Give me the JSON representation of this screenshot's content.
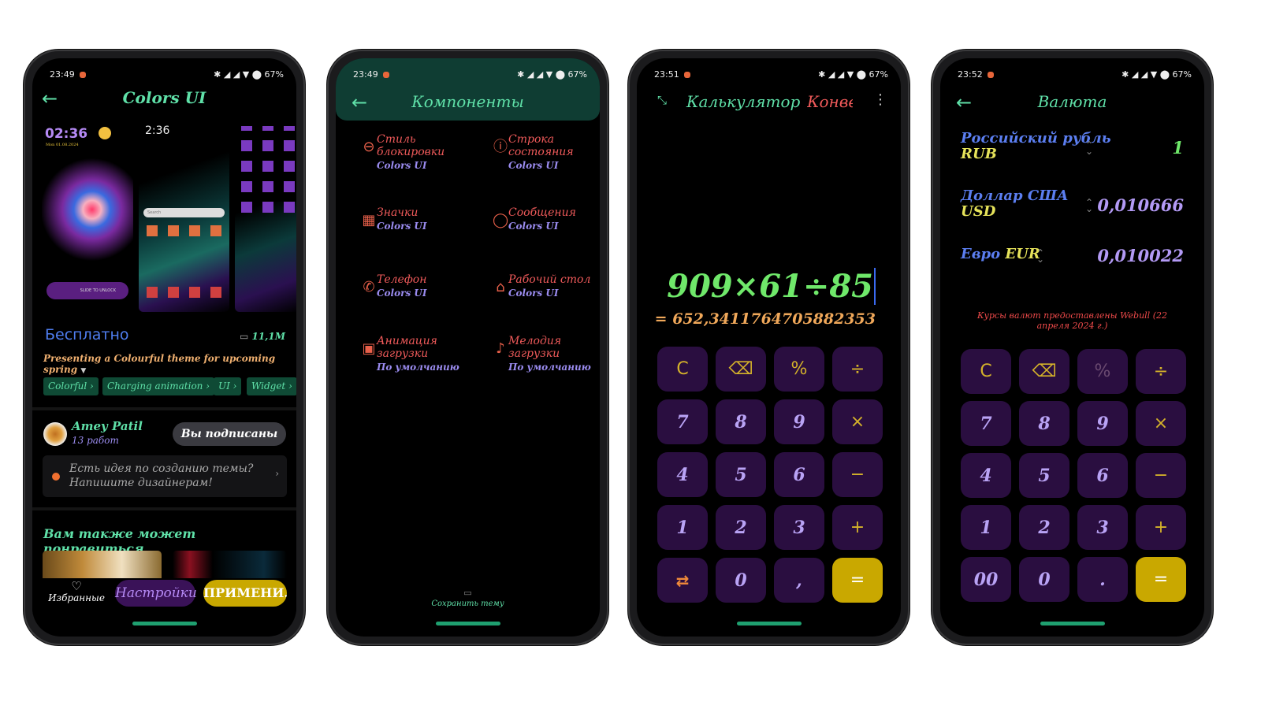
{
  "phone1": {
    "status": {
      "time": "23:49",
      "icons": "✱ ◢ ◢ ▼ ⬤",
      "battery": "67%"
    },
    "title": "Colors UI",
    "preview": {
      "clock1": "02:36",
      "date1": "Mon 01.08.2024",
      "clock2": "2:36",
      "unlock": "SLIDE TO UNLOCK",
      "search": "Search"
    },
    "price": "Бесплатно",
    "size": "11,1M",
    "description": "Presenting a Colourful theme for upcoming spring",
    "tags": [
      "Colorful ›",
      "Charging animation ›",
      "UI ›",
      "Widget ›"
    ],
    "author": {
      "name": "Amey Patil",
      "works": "13 работ",
      "follow": "Вы подписаны"
    },
    "idea": {
      "line1": "Есть идея по созданию темы?",
      "line2": "Напишите дизайнерам!"
    },
    "also": "Вам также может понравиться",
    "bottom": {
      "favorites": "Избранные",
      "settings": "Настройки",
      "apply": "ПРИМЕНИ..."
    }
  },
  "phone2": {
    "status": {
      "time": "23:49",
      "icons": "✱ ◢ ◢ ▼ ⬤",
      "battery": "67%"
    },
    "title": "Компоненты",
    "components": [
      {
        "icon": "lock-icon",
        "title": "Стиль блокировки",
        "sub": "Colors UI"
      },
      {
        "icon": "info-icon",
        "title": "Строка состояния",
        "sub": "Colors UI"
      },
      {
        "icon": "grid-icon",
        "title": "Значки",
        "sub": "Colors UI"
      },
      {
        "icon": "message-icon",
        "title": "Сообщения",
        "sub": "Colors UI"
      },
      {
        "icon": "phone-icon",
        "title": "Телефон",
        "sub": "Colors UI"
      },
      {
        "icon": "home-icon",
        "title": "Рабочий стол",
        "sub": "Colors UI"
      },
      {
        "icon": "boot-animation-icon",
        "title": "Анимация загрузки",
        "sub": "По умолчанию"
      },
      {
        "icon": "ringtone-icon",
        "title": "Мелодия загрузки",
        "sub": "По умолчанию"
      }
    ],
    "save": "Сохранить тему"
  },
  "phone3": {
    "status": {
      "time": "23:51",
      "icons": "✱ ◢ ◢ ▼ ⬤",
      "battery": "67%"
    },
    "tab_calc": "Калькулятор",
    "tab_conv": "Конве",
    "expression": "909×61÷85",
    "result": "= 652,3411764705882353",
    "keys": [
      [
        "C",
        "⌫",
        "%",
        "÷"
      ],
      [
        "7",
        "8",
        "9",
        "×"
      ],
      [
        "4",
        "5",
        "6",
        "−"
      ],
      [
        "1",
        "2",
        "3",
        "+"
      ],
      [
        "⇄",
        "0",
        ",",
        "="
      ]
    ]
  },
  "phone4": {
    "status": {
      "time": "23:52",
      "icons": "✱ ◢ ◢ ▼ ⬤",
      "battery": "67%"
    },
    "title": "Валюта",
    "currencies": [
      {
        "name": "Российский рубль",
        "code": "RUB",
        "value": "1"
      },
      {
        "name": "Доллар США",
        "code": "USD",
        "value": "0,010666"
      },
      {
        "name": "Евро",
        "code": "EUR",
        "value": "0,010022"
      }
    ],
    "note": "Курсы валют предоставлены Webull (22 апреля 2024 г.)",
    "keys": [
      [
        "C",
        "⌫",
        "%",
        "÷"
      ],
      [
        "7",
        "8",
        "9",
        "×"
      ],
      [
        "4",
        "5",
        "6",
        "−"
      ],
      [
        "1",
        "2",
        "3",
        "+"
      ],
      [
        "00",
        "0",
        ".",
        "="
      ]
    ]
  },
  "colors": {
    "accent": "#5fe0a8",
    "key_bg": "#2a0e40",
    "equals": "#c9a800",
    "header": "#0f3d33"
  }
}
